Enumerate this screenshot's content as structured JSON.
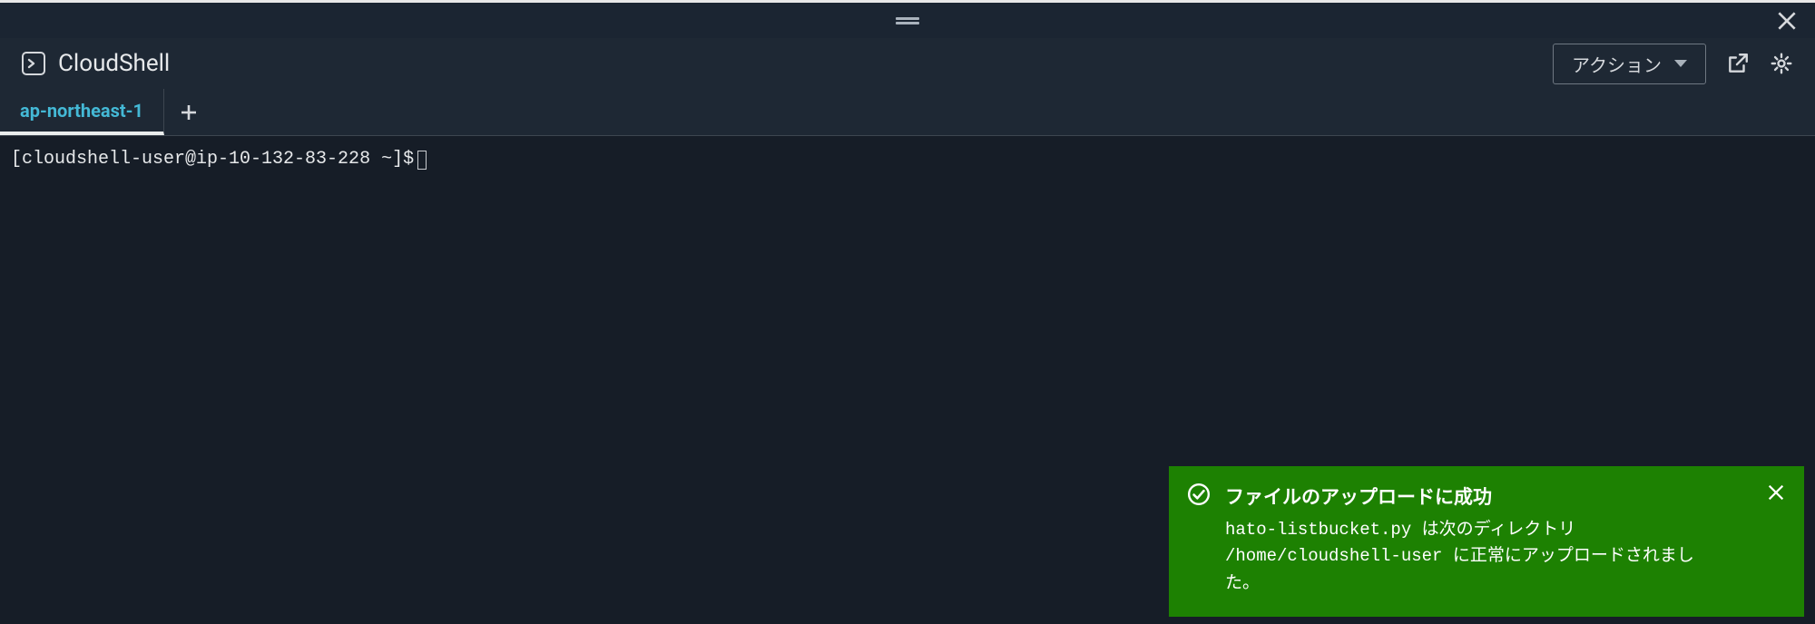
{
  "header": {
    "app_title": "CloudShell",
    "action_label": "アクション"
  },
  "tabs": {
    "items": [
      {
        "label": "ap-northeast-1",
        "active": true
      }
    ]
  },
  "terminal": {
    "prompt": "[cloudshell-user@ip-10-132-83-228 ~]$"
  },
  "toast": {
    "title": "ファイルのアップロードに成功",
    "message": "hato-listbucket.py は次のディレクトリ /home/cloudshell-user に正常にアップロードされました。"
  },
  "colors": {
    "toast_bg": "#1d8102",
    "tab_active_text": "#44b9d6",
    "bg": "#161d27"
  }
}
